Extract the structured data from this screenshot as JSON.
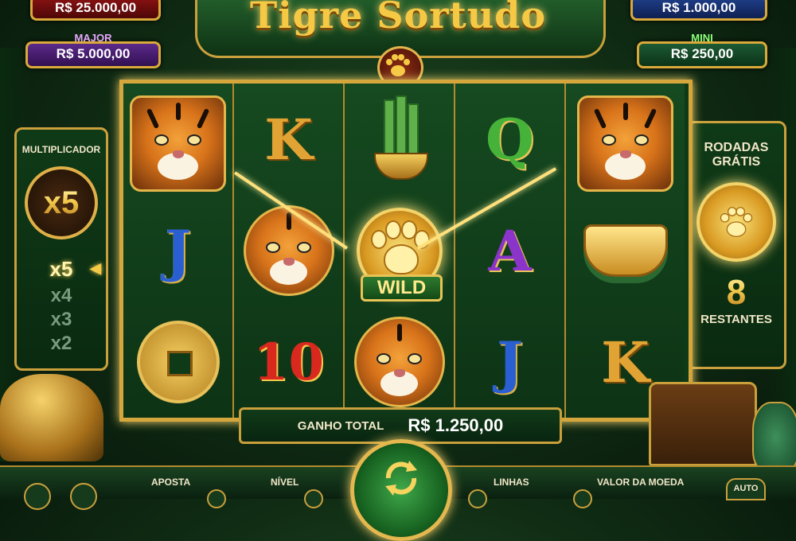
{
  "jackpots": {
    "grand": {
      "value": "R$ 25.000,00"
    },
    "major": {
      "label": "MAJOR",
      "value": "R$ 5.000,00"
    },
    "minor": {
      "value": "R$ 1.000,00"
    },
    "mini": {
      "label": "MINI",
      "value": "R$ 250,00"
    }
  },
  "title": "Tigre Sortudo",
  "multiplier": {
    "title": "MULTIPLICADOR",
    "current": "x5",
    "ladder": [
      "x5",
      "x4",
      "x3",
      "x2"
    ]
  },
  "free_spins": {
    "title_line1": "RODADAS",
    "title_line2": "GRÁTIS",
    "count": "8",
    "remaining_label": "RESTANTES"
  },
  "reels": {
    "wild_label": "WILD",
    "letters": {
      "k": "K",
      "q": "Q",
      "j": "J",
      "a": "A",
      "ten": "10"
    }
  },
  "win": {
    "label": "GANHO TOTAL",
    "value": "R$ 1.250,00"
  },
  "controls": {
    "bet_label": "APOSTA",
    "level_label": "NÍVEL",
    "lines_label": "LINHAS",
    "coin_value_label": "VALOR DA MOEDA",
    "auto_label": "AUTO"
  },
  "colors": {
    "gold": "#d9a93a",
    "jungle": "#0f3a17",
    "major": "#4a1f6e",
    "mini": "#14492a"
  }
}
